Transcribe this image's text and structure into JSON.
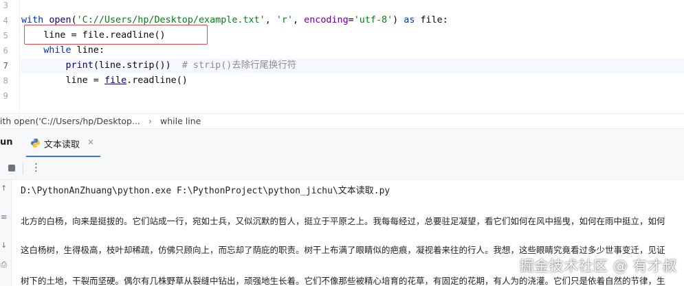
{
  "editor": {
    "line_numbers": [
      "3",
      "4",
      "5",
      "6",
      "7",
      "8",
      "9"
    ],
    "lines": [
      {
        "tokens": [
          {
            "t": "with",
            "c": "kw"
          },
          {
            "t": " ",
            "c": ""
          },
          {
            "t": "open",
            "c": "bi"
          },
          {
            "t": "(",
            "c": ""
          },
          {
            "t": "'C://Users/hp/Desktop/example.txt'",
            "c": "str"
          },
          {
            "t": ", ",
            "c": ""
          },
          {
            "t": "'r'",
            "c": "str"
          },
          {
            "t": ", ",
            "c": ""
          },
          {
            "t": "encoding",
            "c": "param"
          },
          {
            "t": "=",
            "c": ""
          },
          {
            "t": "'utf-8'",
            "c": "str"
          },
          {
            "t": ") ",
            "c": ""
          },
          {
            "t": "as",
            "c": "kw"
          },
          {
            "t": " file:",
            "c": ""
          }
        ]
      },
      {
        "tokens": [
          {
            "t": "    line = file.readline()",
            "c": ""
          }
        ]
      },
      {
        "tokens": [
          {
            "t": "    ",
            "c": ""
          },
          {
            "t": "while",
            "c": "kw"
          },
          {
            "t": " line:",
            "c": ""
          }
        ]
      },
      {
        "tokens": [
          {
            "t": "        ",
            "c": ""
          },
          {
            "t": "print",
            "c": "bi"
          },
          {
            "t": "(line.strip())  ",
            "c": ""
          },
          {
            "t": "# strip()去除行尾换行符",
            "c": "cmt"
          }
        ]
      },
      {
        "tokens": [
          {
            "t": "        line = ",
            "c": ""
          },
          {
            "t": "file",
            "c": "uline"
          },
          {
            "t": ".readline()",
            "c": ""
          }
        ]
      }
    ]
  },
  "breadcrumb": {
    "items": [
      "ith open('C://Users/hp/Desktop...",
      "while line"
    ],
    "separator": "›"
  },
  "run_panel": {
    "label": "un",
    "tab_label": "文本读取",
    "tab_close": "×",
    "more_glyph": "⋮",
    "strip_icons": [
      "↑",
      "≡",
      "↓",
      "⎙"
    ]
  },
  "console": {
    "command": "D:\\PythonAnZhuang\\python.exe F:\\PythonProject\\python_jichu\\文本读取.py",
    "lines": [
      "北方的白杨，向来是挺拔的。它们站成一行，宛如士兵，又似沉默的哲人，挺立于平原之上。我每每经过，总要驻足凝望，看它们如何在风中摇曳，如何在雨中挺立，如何",
      "这白杨树，生得极高，枝叶却稀疏，仿佛只顾向上，而忘却了荫庇的职责。树干上布满了眼睛似的疤痕，凝视着来往的行人。我想，这些眼睛究竟看过多少世事变迁，见证",
      "树下的土地，干裂而坚硬。偶尔有几株野草从裂缝中钻出，顽强地生长着。它们不像那些被精心培育的花草，有固定的花期，有人为的浇灌。它们只是依着自然的节律，生"
    ]
  },
  "watermark": "掘金技术社区 @ 有才叔",
  "colors": {
    "keyword": "#0033b3",
    "string": "#067d17",
    "builtin": "#000080",
    "comment": "#8c8c8c",
    "highlight_box": "#e0474f",
    "tab_underline": "#3574f0"
  }
}
